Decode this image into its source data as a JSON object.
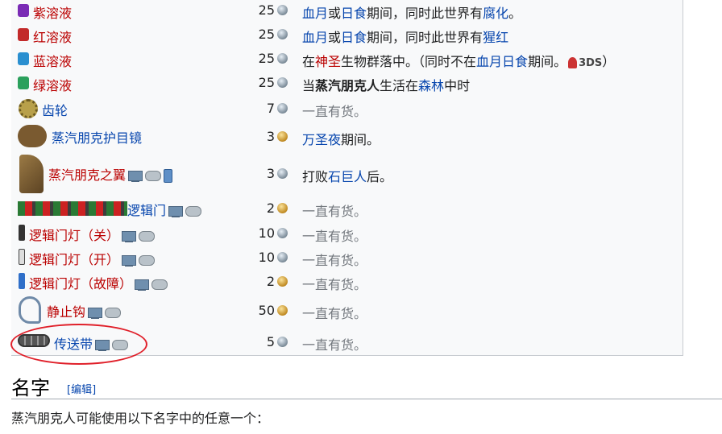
{
  "rows": [
    {
      "name": "紫溶液",
      "price": "25",
      "coin": "silver",
      "availability": [
        {
          "t": "血月",
          "c": "link"
        },
        {
          "t": "或",
          "c": ""
        },
        {
          "t": "日食",
          "c": "link"
        },
        {
          "t": "期间，同时此世界有",
          "c": ""
        },
        {
          "t": "腐化",
          "c": "link"
        },
        {
          "t": "。",
          "c": ""
        }
      ]
    },
    {
      "name": "红溶液",
      "price": "25",
      "coin": "silver",
      "availability": [
        {
          "t": "血月",
          "c": "link"
        },
        {
          "t": "或",
          "c": ""
        },
        {
          "t": "日食",
          "c": "link"
        },
        {
          "t": "期间，同时此世界有",
          "c": ""
        },
        {
          "t": "猩红",
          "c": "link"
        }
      ]
    },
    {
      "name": "蓝溶液",
      "price": "25",
      "coin": "silver",
      "availability": [
        {
          "t": "在",
          "c": ""
        },
        {
          "t": "神圣",
          "c": "red"
        },
        {
          "t": "生物群落中。（同时不在",
          "c": ""
        },
        {
          "t": "血月日食",
          "c": "link"
        },
        {
          "t": "期间。",
          "c": ""
        },
        {
          "t": "3DS",
          "c": "ds3"
        },
        {
          "t": "）",
          "c": ""
        }
      ]
    },
    {
      "name": "绿溶液",
      "price": "25",
      "coin": "silver",
      "availability": [
        {
          "t": "当",
          "c": ""
        },
        {
          "t": "蒸汽朋克人",
          "c": "bold"
        },
        {
          "t": "生活在",
          "c": ""
        },
        {
          "t": "森林",
          "c": "link"
        },
        {
          "t": "中时",
          "c": ""
        }
      ]
    },
    {
      "name": "齿轮",
      "price": "7",
      "coin": "silver",
      "availability": [
        {
          "t": "一直有货。",
          "c": "grey"
        }
      ]
    },
    {
      "name": "蒸汽朋克护目镜",
      "price": "3",
      "coin": "gold",
      "availability": [
        {
          "t": "万圣夜",
          "c": "link"
        },
        {
          "t": "期间。",
          "c": ""
        }
      ]
    },
    {
      "name": "蒸汽朋克之翼",
      "price": "3",
      "coin": "silver",
      "availability": [
        {
          "t": "打败",
          "c": ""
        },
        {
          "t": "石巨人",
          "c": "link"
        },
        {
          "t": "后。",
          "c": ""
        }
      ]
    },
    {
      "name": "逻辑门",
      "price": "2",
      "coin": "gold",
      "availability": [
        {
          "t": "一直有货。",
          "c": "grey"
        }
      ]
    },
    {
      "name": "逻辑门灯（关）",
      "price": "10",
      "coin": "silver",
      "availability": [
        {
          "t": "一直有货。",
          "c": "grey"
        }
      ]
    },
    {
      "name": "逻辑门灯（开）",
      "price": "10",
      "coin": "silver",
      "availability": [
        {
          "t": "一直有货。",
          "c": "grey"
        }
      ]
    },
    {
      "name": "逻辑门灯（故障）",
      "price": "2",
      "coin": "gold",
      "availability": [
        {
          "t": "一直有货。",
          "c": "grey"
        }
      ]
    },
    {
      "name": "静止钩",
      "price": "50",
      "coin": "gold",
      "availability": [
        {
          "t": "一直有货。",
          "c": "grey"
        }
      ]
    },
    {
      "name": "传送带",
      "price": "5",
      "coin": "silver",
      "availability": [
        {
          "t": "一直有货。",
          "c": "grey"
        }
      ]
    }
  ],
  "section": {
    "heading": "名字",
    "edit_label": "[编辑]",
    "intro": "蒸汽朋克人可能使用以下名字中的任意一个："
  },
  "colors": {
    "link": "#0645ad",
    "redlink": "#ba0000",
    "annotation": "#e0202a"
  }
}
